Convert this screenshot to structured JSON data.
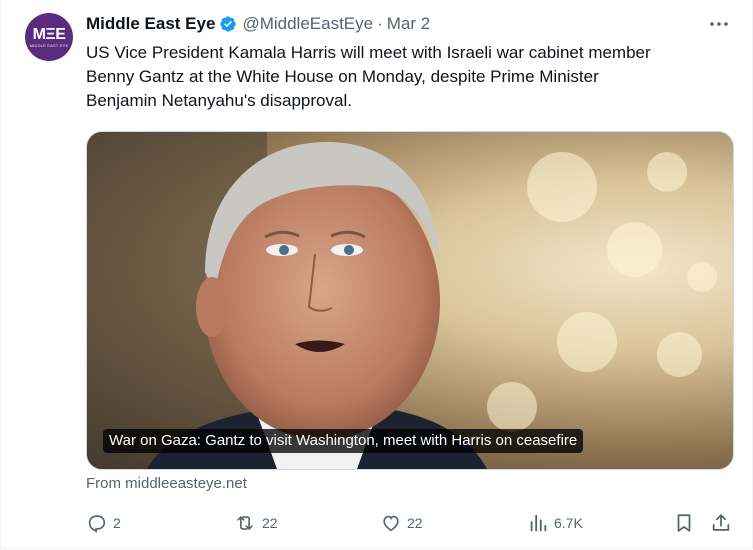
{
  "tweet": {
    "author": {
      "name": "Middle East Eye",
      "handle": "@MiddleEastEye",
      "avatar_mark": "MΞE",
      "avatar_sub": "MIDDLE EAST EYE",
      "avatar_color": "#5b2b7e",
      "verified_icon": "verified-badge-icon"
    },
    "separator": "·",
    "timestamp": "Mar 2",
    "text": "US Vice President Kamala Harris will meet with Israeli war cabinet member\nBenny Gantz at the White House on Monday, despite Prime Minister\nBenjamin Netanyahu's disapproval.",
    "card": {
      "caption": "War on Gaza: Gantz to visit Washington, meet with Harris on ceasefire",
      "source": "From middleeasteye.net"
    },
    "actions": {
      "replies": "2",
      "retweets": "22",
      "likes": "22",
      "views": "6.7K"
    },
    "icons": [
      "more-icon",
      "reply-icon",
      "retweet-icon",
      "like-icon",
      "views-icon",
      "bookmark-icon",
      "share-icon"
    ],
    "colors": {
      "text": "#0f1419",
      "muted": "#536471",
      "verified": "#1d9bf0"
    }
  }
}
